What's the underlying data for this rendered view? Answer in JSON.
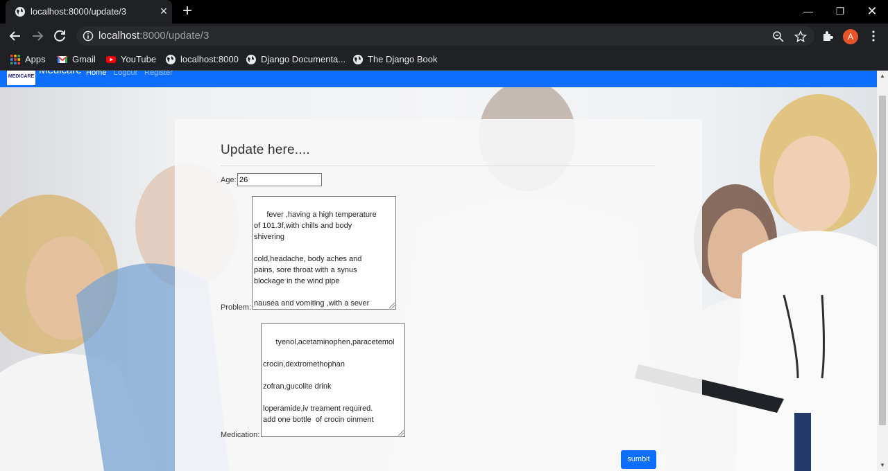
{
  "browser": {
    "tab_title": "localhost:8000/update/3",
    "url_host": "localhost",
    "url_path": ":8000/update/3",
    "avatar_letter": "A",
    "bookmarks": [
      {
        "label": "Apps",
        "icon": "apps-grid-icon"
      },
      {
        "label": "Gmail",
        "icon": "gmail-icon"
      },
      {
        "label": "YouTube",
        "icon": "youtube-icon"
      },
      {
        "label": "localhost:8000",
        "icon": "globe-icon"
      },
      {
        "label": "Django Documenta...",
        "icon": "globe-icon"
      },
      {
        "label": "The Django Book",
        "icon": "globe-icon"
      }
    ]
  },
  "navbar": {
    "logo_text": "MEDICARE",
    "brand": "Medicare",
    "links": [
      "Home",
      "Logout",
      "Register"
    ],
    "color": "#0d6efd"
  },
  "form": {
    "heading": "Update here....",
    "age_label": "Age:",
    "age_value": "26",
    "problem_label": "Problem:",
    "problem_value": "fever ,having a high temperature of 101.3f,with chills and body shivering\n\ncold,headache, body aches and pains, sore throat with a synus blockage in the wind pipe\n\nnausea and vomiting ,with a sever headache and dehydration",
    "medication_label": "Medication:",
    "medication_value": "tyenol,acetaminophen,paracetemol\n\ncrocin,dextromethophan\n\nzofran,gucolite drink\n\nloperamide,iv treament required.\nadd one bottle  of crocin oinment",
    "submit_label": "sumbit"
  }
}
